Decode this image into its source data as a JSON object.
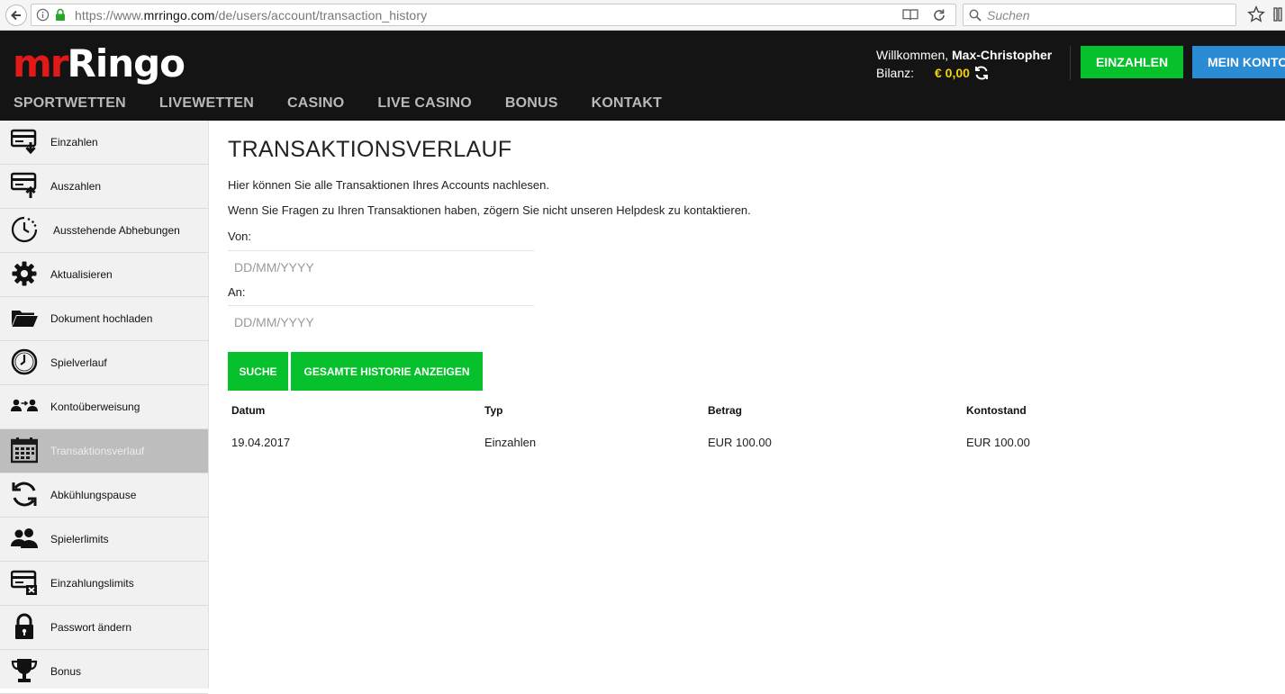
{
  "browser": {
    "url_scheme": "https://www.",
    "url_host": "mrringo.com",
    "url_path": "/de/users/account/transaction_history",
    "search_placeholder": "Suchen"
  },
  "header": {
    "logo_mr": "mr",
    "logo_ringo": "Ringo",
    "welcome_prefix": "Willkommen,",
    "username": "Max-Christopher",
    "balance_label": "Bilanz:",
    "balance_value": "€ 0,00",
    "deposit_button": "EINZAHLEN",
    "account_button": "MEIN KONTO",
    "nav": [
      "SPORTWETTEN",
      "LIVEWETTEN",
      "CASINO",
      "LIVE CASINO",
      "BONUS",
      "KONTAKT"
    ]
  },
  "sidebar": {
    "items": [
      {
        "label": "Einzahlen",
        "icon": "deposit-card-icon"
      },
      {
        "label": "Auszahlen",
        "icon": "withdraw-card-icon"
      },
      {
        "label": "Ausstehende Abhebungen",
        "icon": "pending-clock-icon"
      },
      {
        "label": "Aktualisieren",
        "icon": "gear-icon"
      },
      {
        "label": "Dokument hochladen",
        "icon": "folder-icon"
      },
      {
        "label": "Spielverlauf",
        "icon": "clock-icon"
      },
      {
        "label": "Kontoüberweisung",
        "icon": "user-transfer-icon"
      },
      {
        "label": "Transaktionsverlauf",
        "icon": "calendar-icon",
        "active": true
      },
      {
        "label": "Abkühlungspause",
        "icon": "refresh-icon"
      },
      {
        "label": "Spielerlimits",
        "icon": "users-icon"
      },
      {
        "label": "Einzahlungslimits",
        "icon": "card-limit-icon"
      },
      {
        "label": "Passwort ändern",
        "icon": "lock-icon"
      },
      {
        "label": "Bonus",
        "icon": "trophy-icon"
      }
    ]
  },
  "main": {
    "title": "TRANSAKTIONSVERLAUF",
    "intro1": "Hier können Sie alle Transaktionen Ihres Accounts nachlesen.",
    "intro2": "Wenn Sie Fragen zu Ihren Transaktionen haben, zögern Sie nicht unseren Helpdesk zu kontaktieren.",
    "from_label": "Von:",
    "to_label": "An:",
    "date_placeholder": "DD/MM/YYYY",
    "search_button": "SUCHE",
    "history_button": "GESAMTE HISTORIE ANZEIGEN",
    "table": {
      "headers": [
        "Datum",
        "Typ",
        "Betrag",
        "Kontostand"
      ],
      "rows": [
        [
          "19.04.2017",
          "Einzahlen",
          "EUR 100.00",
          "EUR 100.00"
        ]
      ]
    }
  },
  "colors": {
    "brand_red": "#e11919",
    "green": "#06c12b",
    "blue": "#2b8cd6",
    "balance_yellow": "#f4d20b",
    "header_bg": "#141414"
  }
}
